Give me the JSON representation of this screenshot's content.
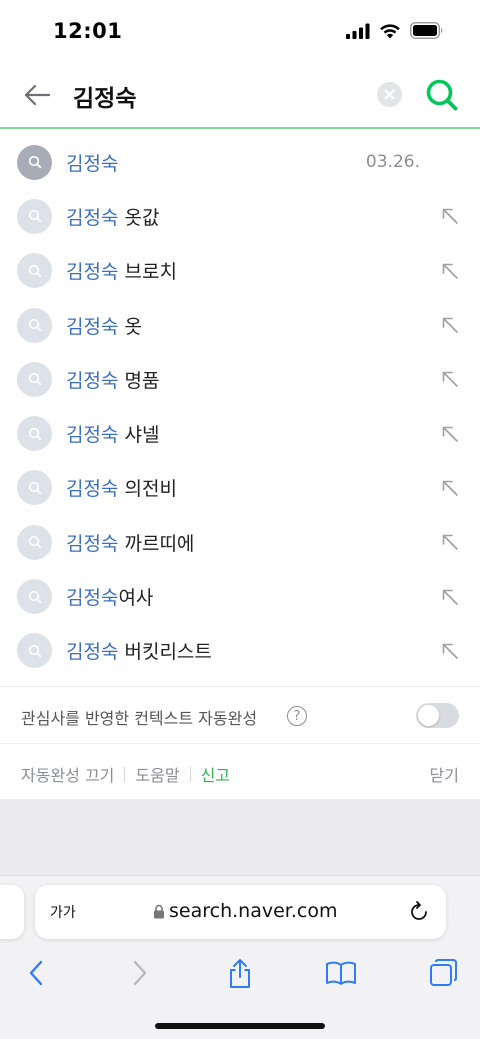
{
  "status": {
    "time": "12:01",
    "signal_icon": "cellular-signal-icon",
    "wifi_icon": "wifi-icon",
    "battery_icon": "battery-icon"
  },
  "search": {
    "query": "김정숙",
    "back_icon": "back-arrow-icon",
    "clear_icon": "clear-icon",
    "search_icon": "search-icon",
    "accent_color": "#03c75a"
  },
  "suggestions": [
    {
      "highlight": "김정숙",
      "rest": "",
      "date": "03.26.",
      "recent": true
    },
    {
      "highlight": "김정숙",
      "rest": " 옷값",
      "date": "",
      "recent": false
    },
    {
      "highlight": "김정숙",
      "rest": " 브로치",
      "date": "",
      "recent": false
    },
    {
      "highlight": "김정숙",
      "rest": " 옷",
      "date": "",
      "recent": false
    },
    {
      "highlight": "김정숙",
      "rest": " 명품",
      "date": "",
      "recent": false
    },
    {
      "highlight": "김정숙",
      "rest": " 샤넬",
      "date": "",
      "recent": false
    },
    {
      "highlight": "김정숙",
      "rest": " 의전비",
      "date": "",
      "recent": false
    },
    {
      "highlight": "김정숙",
      "rest": " 까르띠에",
      "date": "",
      "recent": false
    },
    {
      "highlight": "김정숙",
      "rest": "여사",
      "date": "",
      "recent": false
    },
    {
      "highlight": "김정숙",
      "rest": " 버킷리스트",
      "date": "",
      "recent": false
    }
  ],
  "context": {
    "label": "관심사를 반영한 컨텍스트 자동완성",
    "help": "?",
    "toggle_on": false
  },
  "footer": {
    "autocomplete_off": "자동완성 끄기",
    "help": "도움말",
    "report": "신고",
    "close": "닫기"
  },
  "browser": {
    "aa_label": "가가",
    "url": "search.naver.com",
    "lock_icon": "lock-icon",
    "reload_icon": "reload-icon",
    "toolbar_icons": [
      "back-chevron-icon",
      "forward-chevron-icon",
      "share-icon",
      "bookmarks-icon",
      "tabs-icon"
    ]
  }
}
